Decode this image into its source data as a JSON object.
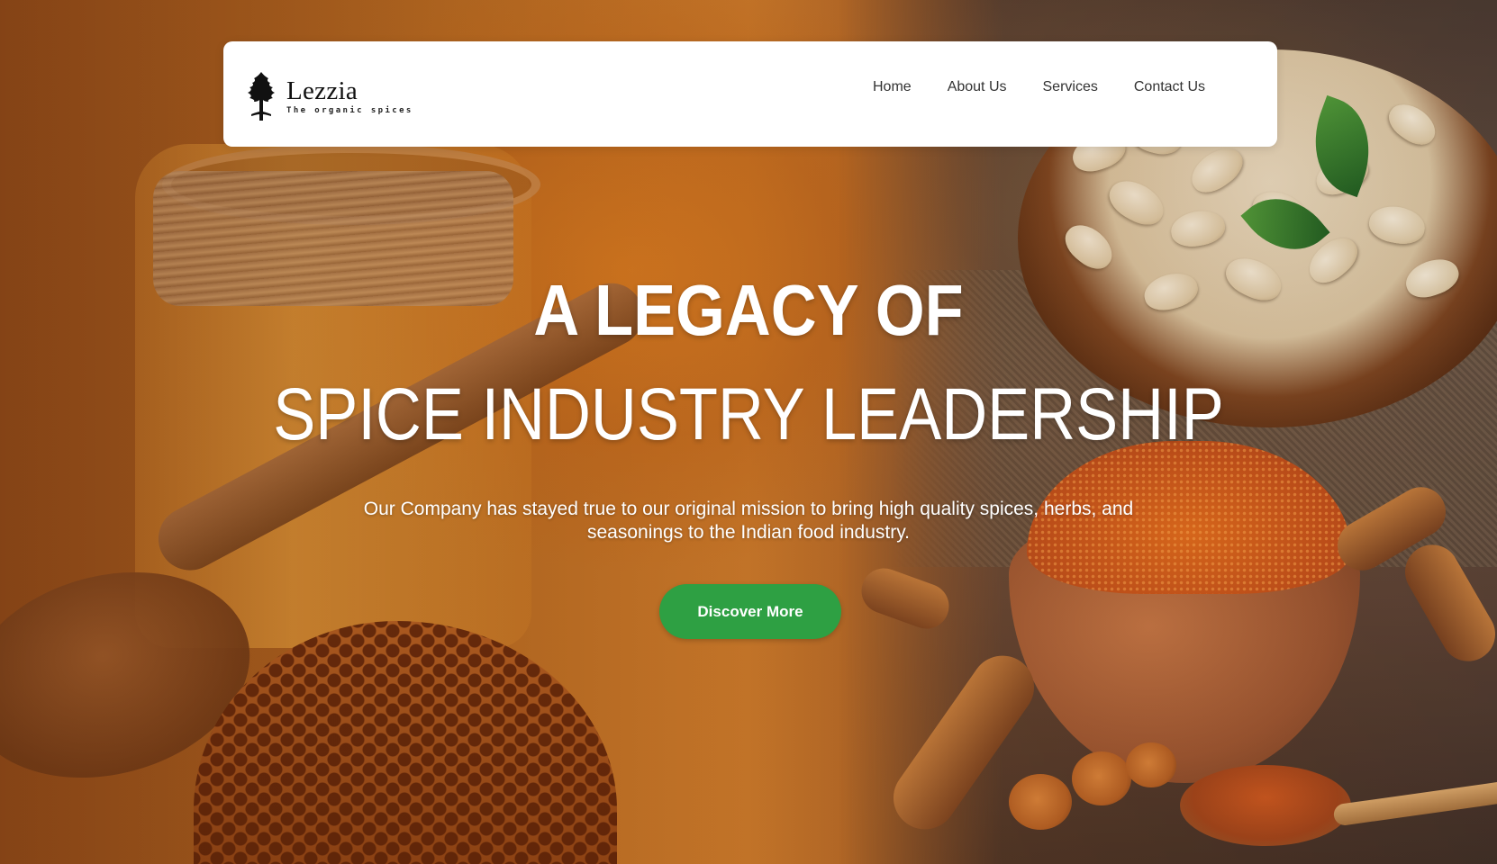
{
  "brand": {
    "name": "Lezzia",
    "tagline": "The organic spices"
  },
  "nav": {
    "items": [
      {
        "label": "Home"
      },
      {
        "label": "About Us"
      },
      {
        "label": "Services"
      },
      {
        "label": "Contact Us"
      }
    ]
  },
  "hero": {
    "headline_line1": "A LEGACY OF",
    "headline_line2": "SPICE INDUSTRY LEADERSHIP",
    "description": "Our Company has stayed true to our original mission to bring high quality spices, herbs, and seasonings to the Indian food industry.",
    "cta_label": "Discover More"
  },
  "colors": {
    "cta_background": "#2ea043",
    "navbar_background": "#ffffff",
    "hero_tone": "#b66a22"
  }
}
